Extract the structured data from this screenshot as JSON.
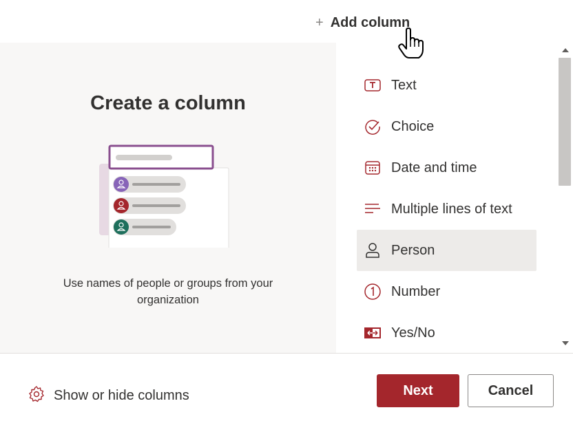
{
  "toolbar": {
    "add_column_label": "Add column",
    "plus_icon": "plus-icon"
  },
  "preview": {
    "title": "Create a column",
    "description": "Use names of people or groups from your organization",
    "illustration": "person-column-illustration",
    "avatar_colors": [
      "#8764b8",
      "#a4262c",
      "#1e6f5c"
    ]
  },
  "column_types": [
    {
      "label": "Text",
      "icon": "text-icon"
    },
    {
      "label": "Choice",
      "icon": "choice-check-icon"
    },
    {
      "label": "Date and time",
      "icon": "calendar-icon"
    },
    {
      "label": "Multiple lines of text",
      "icon": "multiline-text-icon"
    },
    {
      "label": "Person",
      "icon": "person-icon",
      "selected": true
    },
    {
      "label": "Number",
      "icon": "number-icon"
    },
    {
      "label": "Yes/No",
      "icon": "yes-no-icon"
    }
  ],
  "footer": {
    "show_hide_label": "Show or hide columns",
    "show_hide_icon": "gear-icon",
    "next_label": "Next",
    "cancel_label": "Cancel"
  },
  "colors": {
    "accent": "#a4262c",
    "selected_bg": "#edebe9",
    "panel_bg": "#f8f7f6"
  }
}
